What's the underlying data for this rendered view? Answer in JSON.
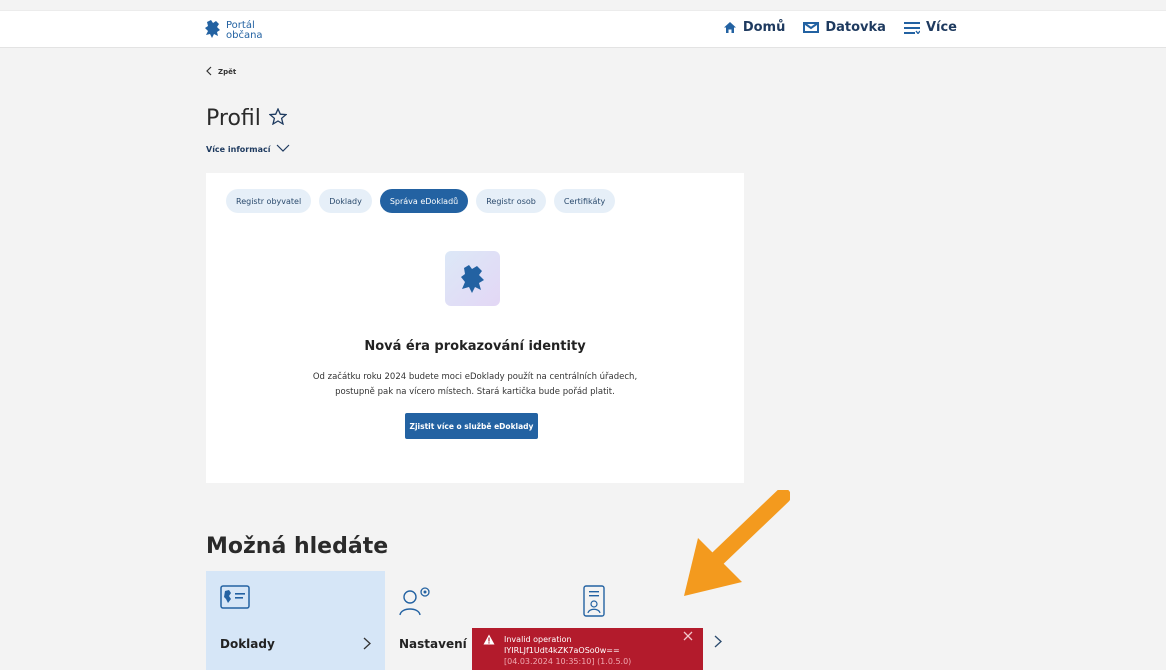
{
  "header": {
    "logo_line1": "Portál",
    "logo_line2": "občana",
    "nav": [
      {
        "label": "Domů",
        "icon": "home-icon"
      },
      {
        "label": "Datovka",
        "icon": "mailbox-icon"
      },
      {
        "label": "Více",
        "icon": "menu-icon"
      }
    ]
  },
  "back_label": "Zpět",
  "page_title": "Profil",
  "more_info_label": "Více informací",
  "tabs": [
    {
      "label": "Registr obyvatel",
      "active": false
    },
    {
      "label": "Doklady",
      "active": false
    },
    {
      "label": "Správa eDokladů",
      "active": true
    },
    {
      "label": "Registr osob",
      "active": false
    },
    {
      "label": "Certifikáty",
      "active": false
    }
  ],
  "card": {
    "title": "Nová éra prokazování identity",
    "text_line1": "Od začátku roku 2024 budete moci eDoklady použít na centrálních úřadech,",
    "text_line2": "postupně pak na vícero místech. Stará kartička bude pořád platit.",
    "cta_label": "Zjistit více o službě eDoklady"
  },
  "suggestions": {
    "title": "Možná hledáte",
    "tiles": [
      {
        "label": "Doklady",
        "icon": "id-card-icon"
      },
      {
        "label": "Nastavení",
        "icon": "user-settings-icon"
      },
      {
        "label": "",
        "icon": "id-badge-icon"
      }
    ]
  },
  "toast": {
    "line1": "Invalid operation",
    "line2": "IYIRLJf1Udt4kZK7aOSo0w==",
    "line3": "[04.03.2024 10:35:10] (1.0.5.0)"
  },
  "colors": {
    "primary": "#2362a2",
    "background": "#f3f3f3",
    "tile_highlight": "#d6e6f7",
    "error": "#b31b2c",
    "annotation_arrow": "#f39a1e"
  }
}
